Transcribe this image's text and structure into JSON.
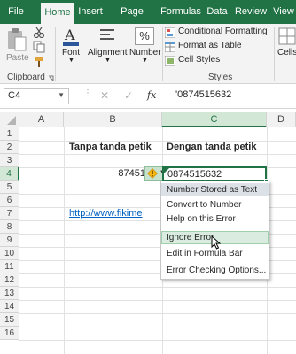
{
  "tabs": [
    "File",
    "Home",
    "Insert",
    "Page Layout",
    "Formulas",
    "Data",
    "Review",
    "View"
  ],
  "ribbon": {
    "paste_label": "Paste",
    "clipboard_label": "Clipboard",
    "font_label": "Font",
    "alignment_label": "Alignment",
    "number_label": "Number",
    "conditional_formatting": "Conditional Formatting",
    "format_as_table": "Format as Table",
    "cell_styles": "Cell Styles",
    "styles_label": "Styles",
    "cells_label": "Cells"
  },
  "formula_bar": {
    "name_box": "C4",
    "fx": "fx",
    "formula": "'0874515632"
  },
  "columns": [
    "A",
    "B",
    "C",
    "D"
  ],
  "rows": [
    "1",
    "2",
    "3",
    "4",
    "5",
    "6",
    "7",
    "8",
    "9",
    "10",
    "11",
    "12",
    "13",
    "14",
    "15",
    "16"
  ],
  "cells": {
    "b2": "Tanpa tanda petik",
    "c2": "Dengan tanda petik",
    "b4": "87451",
    "c4": "0874515632",
    "b7": "http://www.fikime"
  },
  "context_menu": {
    "items": [
      "Number Stored as Text",
      "Convert to Number",
      "Help on this Error",
      "Ignore Error",
      "Edit in Formula Bar",
      "Error Checking Options..."
    ]
  },
  "colors": {
    "brand_green": "#217346",
    "selection_green": "#217346",
    "menu_highlight": "#dce8f5",
    "ignore_hover": "#d9ecdf",
    "link_blue": "#0563c1"
  }
}
